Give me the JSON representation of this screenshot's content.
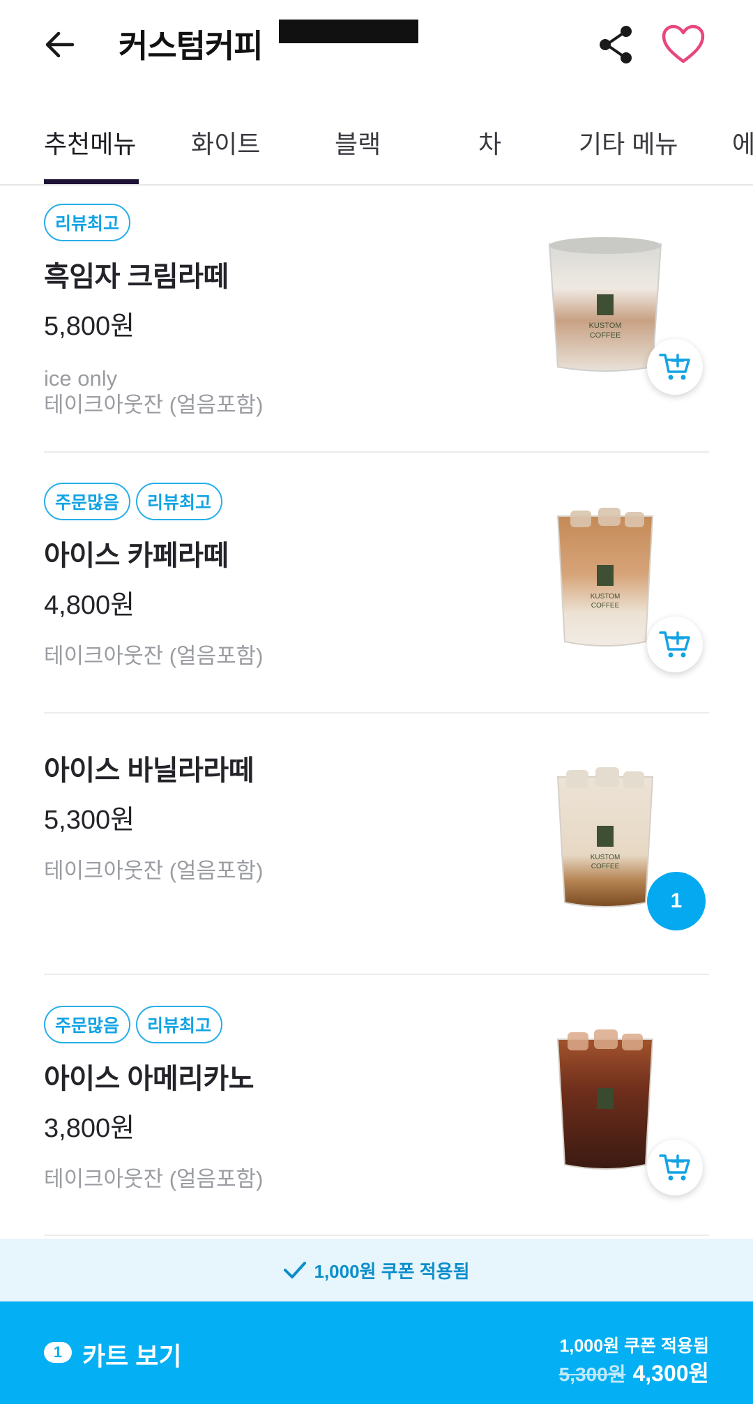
{
  "header": {
    "title": "커스텀커피",
    "back_icon": "arrow-left-icon",
    "share_icon": "share-icon",
    "favorite_icon": "heart-icon"
  },
  "tabs": [
    {
      "label": "추천메뉴",
      "active": true
    },
    {
      "label": "화이트"
    },
    {
      "label": "블랙"
    },
    {
      "label": "차"
    },
    {
      "label": "기타 메뉴"
    },
    {
      "label": "에"
    }
  ],
  "menu": [
    {
      "badges": [
        "리뷰최고"
      ],
      "name": "흑임자 크림라떼",
      "price": "5,800원",
      "note1": "ice only",
      "note2": "테이크아웃잔 (얼음포함)",
      "cart_icon": "cart-add-icon"
    },
    {
      "badges": [
        "주문많음",
        "리뷰최고"
      ],
      "name": "아이스 카페라떼",
      "price": "4,800원",
      "note1": "",
      "note2": "테이크아웃잔 (얼음포함)",
      "cart_icon": "cart-add-icon"
    },
    {
      "badges": [],
      "name": "아이스 바닐라라떼",
      "price": "5,300원",
      "note1": "",
      "note2": "테이크아웃잔 (얼음포함)",
      "quantity": "1"
    },
    {
      "badges": [
        "주문많음",
        "리뷰최고"
      ],
      "name": "아이스 아메리카노",
      "price": "3,800원",
      "note1": "",
      "note2": "테이크아웃잔 (얼음포함)",
      "cart_icon": "cart-add-icon"
    }
  ],
  "coupon_strip": {
    "text": "1,000원 쿠폰 적용됨",
    "icon": "check-icon"
  },
  "cart_bar": {
    "count": "1",
    "label": "카트 보기",
    "coupon_text": "1,000원 쿠폰 적용됨",
    "original_price": "5,300원",
    "final_price": "4,300원"
  },
  "colors": {
    "accent": "#04b0f3",
    "badge": "#12a3e4",
    "heart": "#e8467c",
    "tab_indicator": "#1e1236"
  }
}
